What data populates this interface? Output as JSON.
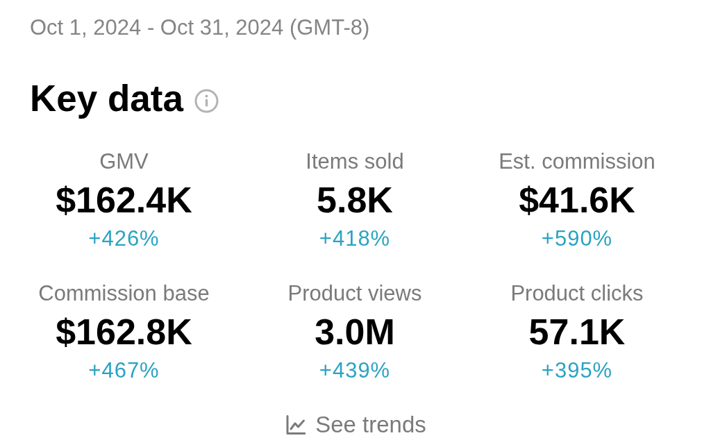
{
  "date_range": "Oct 1, 2024 - Oct 31, 2024 (GMT-8)",
  "section": {
    "title": "Key data"
  },
  "metrics": [
    {
      "label": "GMV",
      "value": "$162.4K",
      "change": "+426%"
    },
    {
      "label": "Items sold",
      "value": "5.8K",
      "change": "+418%"
    },
    {
      "label": "Est. commission",
      "value": "$41.6K",
      "change": "+590%"
    },
    {
      "label": "Commission base",
      "value": "$162.8K",
      "change": "+467%"
    },
    {
      "label": "Product views",
      "value": "3.0M",
      "change": "+439%"
    },
    {
      "label": "Product clicks",
      "value": "57.1K",
      "change": "+395%"
    }
  ],
  "see_trends": {
    "label": "See trends"
  }
}
